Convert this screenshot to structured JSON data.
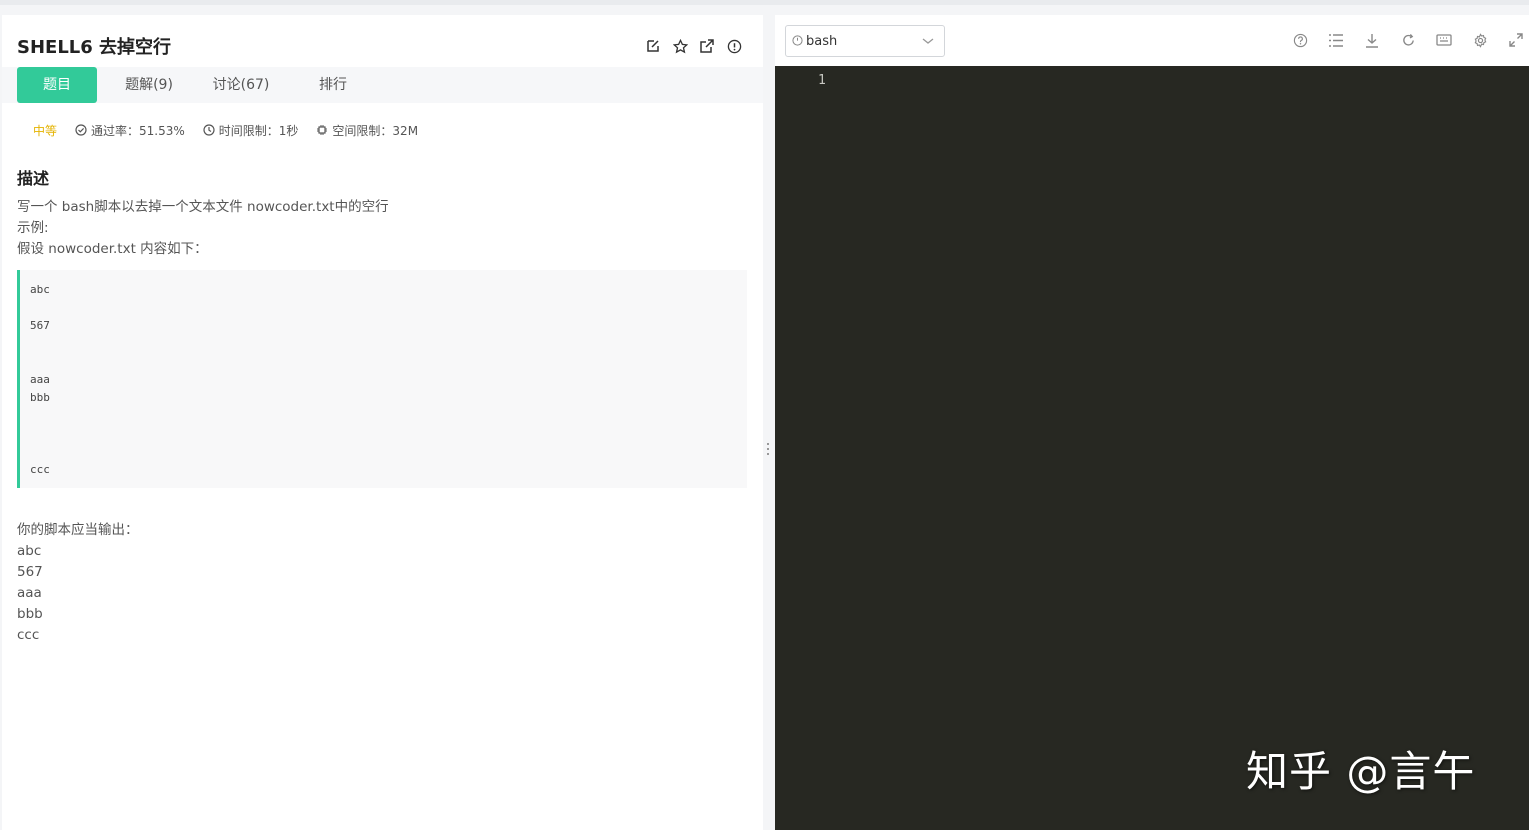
{
  "problem": {
    "title": "SHELL6  去掉空行"
  },
  "title_icons": [
    "edit-icon",
    "star-icon",
    "external-link-icon",
    "info-icon"
  ],
  "tabs": [
    {
      "label": "题目",
      "active": true
    },
    {
      "label": "题解(9)",
      "active": false
    },
    {
      "label": "讨论(67)",
      "active": false
    },
    {
      "label": "排行",
      "active": false
    }
  ],
  "meta": {
    "difficulty": "中等",
    "pass_rate": "通过率：51.53%",
    "time_limit": "时间限制：1秒",
    "space_limit": "空间限制：32M"
  },
  "description": {
    "heading": "描述",
    "line1": "写一个 bash脚本以去掉一个文本文件 nowcoder.txt中的空行",
    "line2": "示例:",
    "line3": "假设 nowcoder.txt 内容如下：",
    "code_lines": [
      "abc",
      "567",
      "aaa",
      "bbb",
      "ccc"
    ],
    "output_heading": "你的脚本应当输出：",
    "output_lines": [
      "abc",
      "567",
      "aaa",
      "bbb",
      "ccc"
    ]
  },
  "editor": {
    "language": "bash",
    "line_number": "1",
    "toolbar_icons": [
      "help-icon",
      "list-icon",
      "download-icon",
      "refresh-icon",
      "keyboard-icon",
      "settings-icon",
      "fullscreen-icon"
    ]
  },
  "watermark": "知乎 @言午",
  "colors": {
    "accent": "#32ca99",
    "editor_bg": "#272822",
    "difficulty": "#e4b300"
  }
}
